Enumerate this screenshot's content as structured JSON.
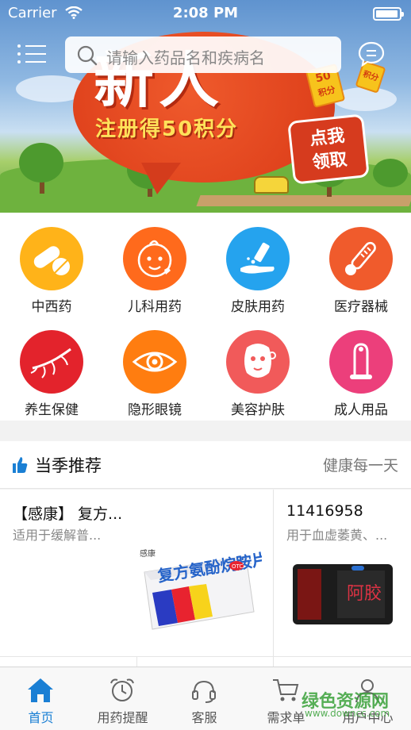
{
  "status_bar": {
    "carrier": "Carrier",
    "time": "2:08 PM",
    "battery_level": 0.95
  },
  "header": {
    "search_placeholder": "请输入药品名和疾病名",
    "menu_icon": "list-icon",
    "message_icon": "chat-icon"
  },
  "banner": {
    "headline": "新人",
    "subtitle": "注册得50积分",
    "cta_line1": "点我",
    "cta_line2": "领取",
    "coupon_a": "50",
    "coupon_a_sub": "积分",
    "coupon_b": "积分"
  },
  "categories": [
    {
      "label": "中西药",
      "color": "#ffb319",
      "icon": "pills-icon"
    },
    {
      "label": "儿科用药",
      "color": "#ff6a1c",
      "icon": "baby-icon"
    },
    {
      "label": "皮肤用药",
      "color": "#25a3ee",
      "icon": "skin-cream-icon"
    },
    {
      "label": "医疗器械",
      "color": "#f05b2c",
      "icon": "thermometer-icon"
    },
    {
      "label": "养生保健",
      "color": "#e3232c",
      "icon": "ginseng-icon"
    },
    {
      "label": "隐形眼镜",
      "color": "#ff7d10",
      "icon": "eye-icon"
    },
    {
      "label": "美容护肤",
      "color": "#f15a5a",
      "icon": "face-mask-icon"
    },
    {
      "label": "成人用品",
      "color": "#ec3f7b",
      "icon": "condom-icon"
    }
  ],
  "section": {
    "title": "当季推荐",
    "more": "健康每一天"
  },
  "products": [
    {
      "name": "【感康】 复方...",
      "desc": "适用于缓解普...",
      "brand_on_box": "感康",
      "box_text": "复方氨酚烷胺片",
      "box_badge": "OTC"
    },
    {
      "name": "11416958",
      "desc": "用于血虚萎黄、...",
      "box_text": "阿胶"
    }
  ],
  "tabbar": [
    {
      "label": "首页",
      "icon": "home-icon",
      "active": true
    },
    {
      "label": "用药提醒",
      "icon": "alarm-clock-icon",
      "active": false
    },
    {
      "label": "客服",
      "icon": "headset-icon",
      "active": false
    },
    {
      "label": "需求单",
      "icon": "cart-icon",
      "active": false
    },
    {
      "label": "用户中心",
      "icon": "user-icon",
      "active": false
    }
  ],
  "watermark": {
    "text": "绿色资源网",
    "url": "www.downcc.com"
  },
  "colors": {
    "accent": "#1a7fd4",
    "banner_red": "#e0431d"
  }
}
